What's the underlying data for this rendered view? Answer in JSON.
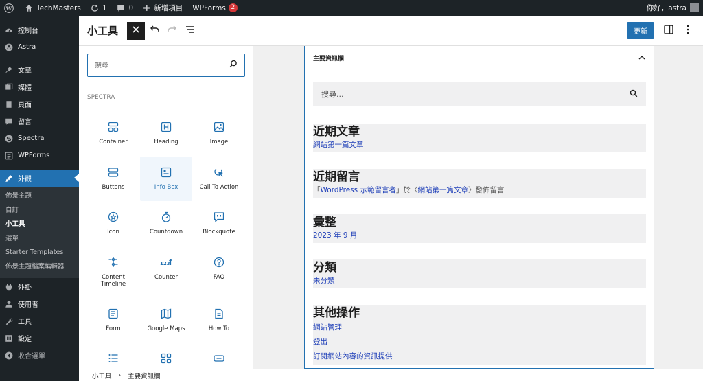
{
  "admin_bar": {
    "site_name": "TechMasters",
    "updates_count": "1",
    "comments_count": "0",
    "new_label": "新增項目",
    "wpforms_label": "WPForms",
    "wpforms_badge": "2",
    "greeting": "你好，astra"
  },
  "sidebar": {
    "items_top": [
      {
        "label": "控制台",
        "icon": "dashboard-icon"
      },
      {
        "label": "Astra",
        "icon": "astra-icon"
      },
      {
        "label": "文章",
        "icon": "pin-icon"
      },
      {
        "label": "媒體",
        "icon": "media-icon"
      },
      {
        "label": "頁面",
        "icon": "page-icon"
      },
      {
        "label": "留言",
        "icon": "comment-icon"
      },
      {
        "label": "Spectra",
        "icon": "spectra-icon"
      },
      {
        "label": "WPForms",
        "icon": "wpforms-icon"
      }
    ],
    "active": {
      "label": "外觀",
      "icon": "brush-icon"
    },
    "submenu": [
      "佈景主題",
      "自訂",
      "小工具",
      "選單",
      "Starter Templates",
      "佈景主題檔案編輯器"
    ],
    "items_bottom": [
      {
        "label": "外掛",
        "icon": "plugin-icon"
      },
      {
        "label": "使用者",
        "icon": "user-icon"
      },
      {
        "label": "工具",
        "icon": "wrench-icon"
      },
      {
        "label": "設定",
        "icon": "settings-icon"
      },
      {
        "label": "收合選單",
        "icon": "collapse-icon"
      }
    ]
  },
  "editor": {
    "title": "小工具",
    "update_label": "更新"
  },
  "inserter": {
    "search_placeholder": "搜尋",
    "category": "SPECTRA",
    "blocks": [
      "Container",
      "Heading",
      "Image",
      "Buttons",
      "Info Box",
      "Call To Action",
      "Icon",
      "Countdown",
      "Blockquote",
      "Content Timeline",
      "Counter",
      "FAQ",
      "Form",
      "Google Maps",
      "How To",
      "",
      "",
      ""
    ]
  },
  "canvas": {
    "area_title": "主要資訊欄",
    "search_placeholder": "搜尋...",
    "widgets": [
      {
        "title": "近期文章",
        "link": "網站第一篇文章"
      },
      {
        "title": "近期留言",
        "pre": "「",
        "author": "WordPress 示範留言者",
        "mid": "」於〈",
        "post_link": "網站第一篇文章",
        "post": "〉發佈留言"
      },
      {
        "title": "彙整",
        "link": "2023 年 9 月"
      },
      {
        "title": "分類",
        "link": "未分類"
      },
      {
        "title": "其他操作",
        "links": [
          "網站管理",
          "登出",
          "訂閱網站內容的資訊提供"
        ]
      }
    ]
  },
  "footer": {
    "crumb_root": "小工具",
    "crumb_current": "主要資訊欄"
  }
}
